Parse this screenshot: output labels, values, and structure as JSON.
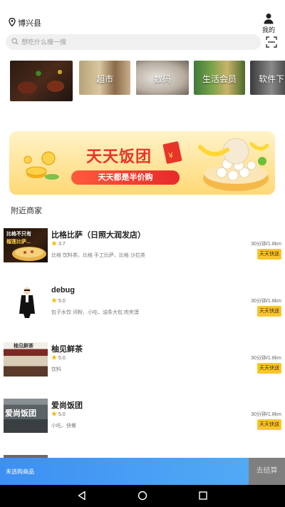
{
  "header": {
    "location": "博兴县",
    "location_icon": "location-pin-icon",
    "mine_label": "我的",
    "mine_icon": "user-icon"
  },
  "search": {
    "placeholder": "想吃什么搜一搜",
    "scan_icon": "scan-icon"
  },
  "categories": [
    {
      "label": ""
    },
    {
      "label": "超市"
    },
    {
      "label": "数码"
    },
    {
      "label": "生活会员"
    },
    {
      "label": "软件下"
    }
  ],
  "banner": {
    "title": "天天饭团",
    "subtitle": "天天都是半价购"
  },
  "section": {
    "title": "附近商家"
  },
  "merchants": [
    {
      "name": "比格比萨（日照大润发店）",
      "rating": "3.7",
      "tags": "比格 饮料类、比格 手工比萨、比格 沙拉类",
      "eta": "30分钟/1.8km",
      "badge": "天天快送",
      "thumb_text": "比格不只有",
      "thumb_text2": "榴莲比萨..."
    },
    {
      "name": "debug",
      "rating": "5.0",
      "tags": "包子水饺 河粉、小吃、油条大包 肉夹馍",
      "eta": "30分钟/1.8km",
      "badge": "天天快送"
    },
    {
      "name": "柚见鲜茶",
      "rating": "5.0",
      "tags": "饮料",
      "eta": "30分钟/1.8km",
      "badge": "天天快送",
      "thumb_text": "柚见鲜茶"
    },
    {
      "name": "爱尚饭团",
      "rating": "5.0",
      "tags": "小吃、快餐",
      "eta": "30分钟/1.8km",
      "badge": "天天快送",
      "thumb_text": "爱尚饭团"
    }
  ],
  "cart": {
    "status": "未选购商品",
    "checkout": "去结算"
  },
  "colors": {
    "accent_blue": "#3d8ff2",
    "badge_yellow": "#f9c62a",
    "banner_red": "#e8342a"
  }
}
